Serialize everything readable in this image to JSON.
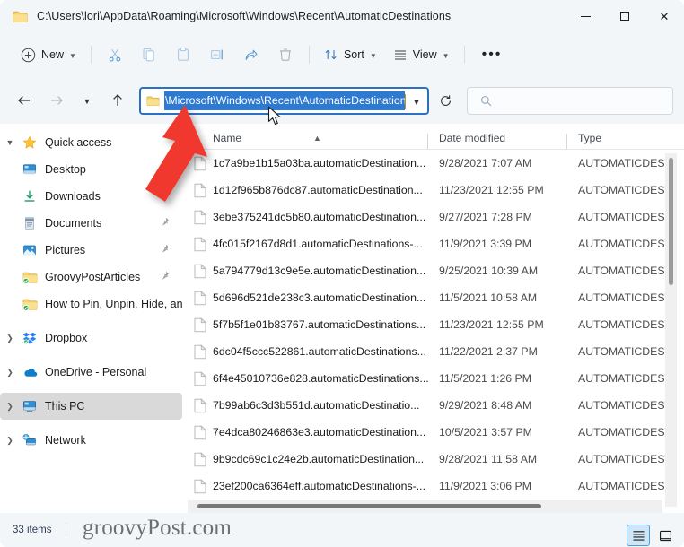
{
  "window": {
    "title": "C:\\Users\\lori\\AppData\\Roaming\\Microsoft\\Windows\\Recent\\AutomaticDestinations",
    "minimize_label": "Minimize",
    "maximize_label": "Maximize",
    "close_label": "Close"
  },
  "toolbar": {
    "new_label": "New",
    "cut_label": "Cut",
    "copy_label": "Copy",
    "paste_label": "Paste",
    "rename_label": "Rename",
    "share_label": "Share",
    "delete_label": "Delete",
    "sort_label": "Sort",
    "view_label": "View",
    "more_label": "See more"
  },
  "navigation": {
    "back_label": "Back",
    "forward_label": "Forward",
    "recent_label": "Recent locations",
    "up_label": "Up",
    "refresh_label": "Refresh",
    "address_value": "\\Microsoft\\Windows\\Recent\\AutomaticDestinations",
    "address_dropdown_label": "Previous locations"
  },
  "search": {
    "value": "",
    "placeholder": ""
  },
  "sidebar": {
    "items": [
      {
        "label": "Quick access",
        "icon": "star-icon",
        "expander": "chevron-down",
        "indent": false,
        "pinned": false,
        "selected": false
      },
      {
        "label": "Desktop",
        "icon": "desktop-icon",
        "expander": "",
        "indent": true,
        "pinned": true,
        "selected": false
      },
      {
        "label": "Downloads",
        "icon": "downloads-icon",
        "expander": "",
        "indent": true,
        "pinned": true,
        "selected": false
      },
      {
        "label": "Documents",
        "icon": "documents-icon",
        "expander": "",
        "indent": true,
        "pinned": true,
        "selected": false
      },
      {
        "label": "Pictures",
        "icon": "pictures-icon",
        "expander": "",
        "indent": true,
        "pinned": true,
        "selected": false
      },
      {
        "label": "GroovyPostArticles",
        "icon": "folder-sync-icon",
        "expander": "",
        "indent": true,
        "pinned": true,
        "selected": false
      },
      {
        "label": "How to Pin, Unpin, Hide, and Re",
        "icon": "folder-sync-icon",
        "expander": "",
        "indent": true,
        "pinned": false,
        "selected": false
      },
      {
        "label": "Dropbox",
        "icon": "dropbox-icon",
        "expander": "chevron-right",
        "indent": false,
        "pinned": false,
        "selected": false
      },
      {
        "label": "OneDrive - Personal",
        "icon": "onedrive-icon",
        "expander": "chevron-right",
        "indent": false,
        "pinned": false,
        "selected": false
      },
      {
        "label": "This PC",
        "icon": "thispc-icon",
        "expander": "chevron-right",
        "indent": false,
        "pinned": false,
        "selected": true
      },
      {
        "label": "Network",
        "icon": "network-icon",
        "expander": "chevron-right",
        "indent": false,
        "pinned": false,
        "selected": false
      }
    ]
  },
  "filelist": {
    "columns": [
      {
        "label": "Name",
        "sort": "asc"
      },
      {
        "label": "Date modified",
        "sort": ""
      },
      {
        "label": "Type",
        "sort": ""
      }
    ],
    "rows": [
      {
        "name": "1c7a9be1b15a03ba.automaticDestination...",
        "date": "9/28/2021 7:07 AM",
        "type": "AUTOMATICDEST"
      },
      {
        "name": "1d12f965b876dc87.automaticDestination...",
        "date": "11/23/2021 12:55 PM",
        "type": "AUTOMATICDEST"
      },
      {
        "name": "3ebe375241dc5b80.automaticDestination...",
        "date": "9/27/2021 7:28 PM",
        "type": "AUTOMATICDEST"
      },
      {
        "name": "4fc015f2167d8d1.automaticDestinations-...",
        "date": "11/9/2021 3:39 PM",
        "type": "AUTOMATICDEST"
      },
      {
        "name": "5a794779d13c9e5e.automaticDestination...",
        "date": "9/25/2021 10:39 AM",
        "type": "AUTOMATICDEST"
      },
      {
        "name": "5d696d521de238c3.automaticDestination...",
        "date": "11/5/2021 10:58 AM",
        "type": "AUTOMATICDEST"
      },
      {
        "name": "5f7b5f1e01b83767.automaticDestinations...",
        "date": "11/23/2021 12:55 PM",
        "type": "AUTOMATICDEST"
      },
      {
        "name": "6dc04f5ccc522861.automaticDestinations...",
        "date": "11/22/2021 2:37 PM",
        "type": "AUTOMATICDEST"
      },
      {
        "name": "6f4e45010736e828.automaticDestinations...",
        "date": "11/5/2021 1:26 PM",
        "type": "AUTOMATICDEST"
      },
      {
        "name": "7b99ab6c3d3b551d.automaticDestinatio...",
        "date": "9/29/2021 8:48 AM",
        "type": "AUTOMATICDEST"
      },
      {
        "name": "7e4dca80246863e3.automaticDestination...",
        "date": "10/5/2021 3:57 PM",
        "type": "AUTOMATICDEST"
      },
      {
        "name": "9b9cdc69c1c24e2b.automaticDestination...",
        "date": "9/28/2021 11:58 AM",
        "type": "AUTOMATICDEST"
      },
      {
        "name": "23ef200ca6364eff.automaticDestinations-...",
        "date": "11/9/2021 3:06 PM",
        "type": "AUTOMATICDEST"
      }
    ]
  },
  "statusbar": {
    "items_count": "33 items",
    "details_view_label": "Details view",
    "tiles_view_label": "Large icons view"
  },
  "watermark": {
    "text": "groovyPost.com"
  },
  "annotation": {
    "arrow_color": "#f0372f",
    "arrow_target": "address-bar"
  },
  "colors": {
    "accent": "#2f7ad1",
    "selection_blue": "#2f7ad1",
    "titlebar_bg": "#f3f6f9",
    "sidebar_selected": "#d9d9d9"
  }
}
